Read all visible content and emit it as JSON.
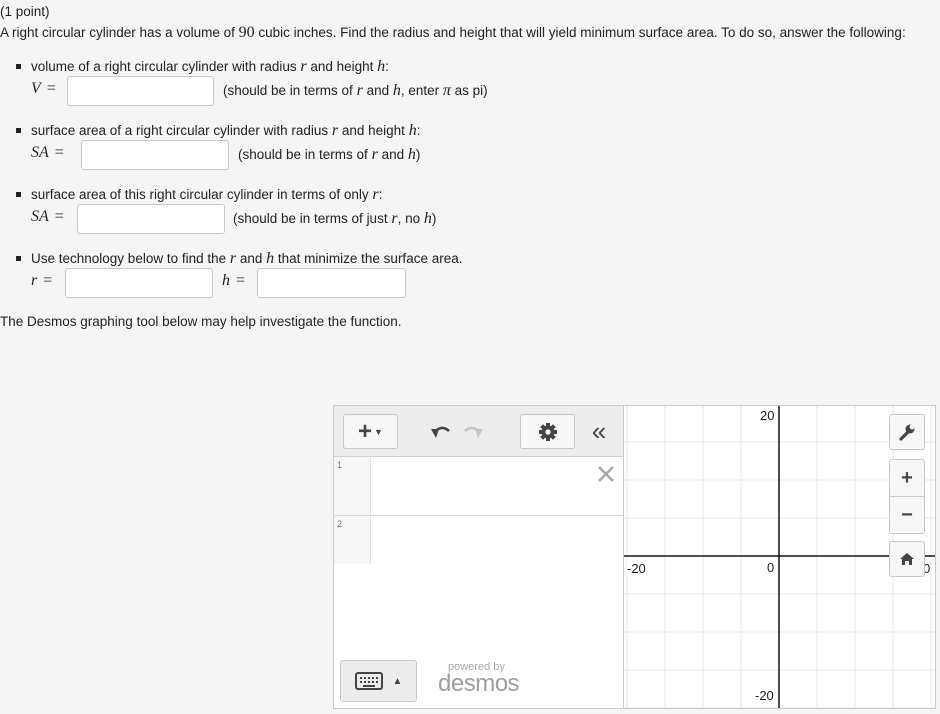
{
  "problem": {
    "points": "(1 point)",
    "intro_a": "A right circular cylinder has a volume of ",
    "volume_value": "90",
    "intro_b": " cubic inches. Find the radius and height that will yield minimum surface area. To do so, answer the following:",
    "items": [
      {
        "text_a": "volume of a right circular cylinder with radius ",
        "var1": "r",
        "text_b": " and height ",
        "var2": "h",
        "text_c": ":",
        "lhs": "V",
        "hint_a": "(should be in terms of ",
        "hint_var1": "r",
        "hint_b": " and ",
        "hint_var2": "h",
        "hint_c": ", enter ",
        "hint_pi": "π",
        "hint_d": " as pi)"
      },
      {
        "text_a": "surface area of a right circular cylinder with radius ",
        "var1": "r",
        "text_b": " and height ",
        "var2": "h",
        "text_c": ":",
        "lhs": "SA",
        "hint_a": "(should be in terms of ",
        "hint_var1": "r",
        "hint_b": " and ",
        "hint_var2": "h",
        "hint_c": ")"
      },
      {
        "text_a": "surface area of this right circular cylinder in terms of only ",
        "var1": "r",
        "text_b": ":",
        "lhs": "SA",
        "hint_a": "(should be in terms of just ",
        "hint_var1": "r",
        "hint_b": ", no ",
        "hint_var2": "h",
        "hint_c": ")"
      },
      {
        "text_a": "Use technology below to find the ",
        "var1": "r",
        "text_b": " and ",
        "var2": "h",
        "text_c": " that minimize the surface area.",
        "lhs_r": "r",
        "lhs_h": "h"
      }
    ],
    "equals": "=",
    "inputs": {
      "v": "",
      "sa": "",
      "sa_r": "",
      "r": "",
      "h": ""
    },
    "desmos_note": "The Desmos graphing tool below may help investigate the function."
  },
  "desmos": {
    "expressions": [
      {
        "index": "1",
        "value": ""
      },
      {
        "index": "2",
        "value": ""
      }
    ],
    "powered_by": "powered by",
    "brand": "desmos",
    "axis_labels": {
      "y_top": "20",
      "y_bottom": "-20",
      "x_left": "-20",
      "origin": "0",
      "x_right": "0"
    },
    "colors": {
      "grid": "#e6e6e6",
      "axis": "#111111",
      "panel": "#ededed"
    }
  }
}
